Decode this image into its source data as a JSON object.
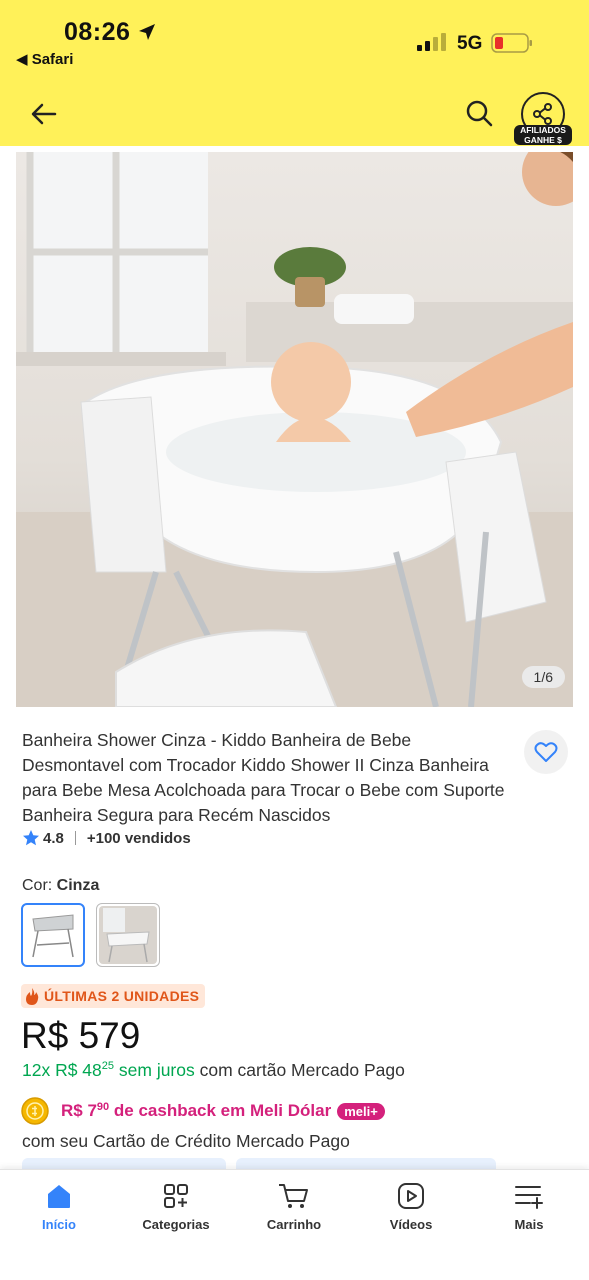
{
  "status_bar": {
    "time": "08:26",
    "back_app": "◀ Safari",
    "network": "5G"
  },
  "header": {
    "affiliate_badge_line1": "AFILIADOS",
    "affiliate_badge_line2": "GANHE $",
    "accent_color": "#fff159"
  },
  "gallery": {
    "counter": "1/6"
  },
  "product": {
    "title": "Banheira Shower Cinza - Kiddo Banheira de Bebe Desmontavel com Trocador Kiddo Shower II Cinza Banheira para Bebe Mesa Acolchoada para Trocar o Bebe com Suporte Banheira Segura para Recém Nascidos",
    "rating": "4.8",
    "sold": "+100 vendidos",
    "color_label": "Cor: ",
    "color_value": "Cinza",
    "badge": "ÚLTIMAS 2 UNIDADES",
    "price": "R$ 579",
    "installments_prefix": "12x R$ 48",
    "installments_cents": "25",
    "installments_suffix": " sem juros",
    "installments_card": " com cartão Mercado Pago",
    "cashback_prefix": "R$ 7",
    "cashback_cents": "90",
    "cashback_suffix": " de cashback em Meli Dólar",
    "meli_badge": "meli+",
    "card_line": "com seu Cartão de Crédito Mercado Pago"
  },
  "bottom_nav": {
    "items": [
      {
        "label": "Início",
        "icon": "home-icon",
        "active": true
      },
      {
        "label": "Categorias",
        "icon": "categories-icon"
      },
      {
        "label": "Carrinho",
        "icon": "cart-icon"
      },
      {
        "label": "Vídeos",
        "icon": "video-icon"
      },
      {
        "label": "Mais",
        "icon": "more-icon"
      }
    ],
    "active_color": "#3483fa"
  }
}
